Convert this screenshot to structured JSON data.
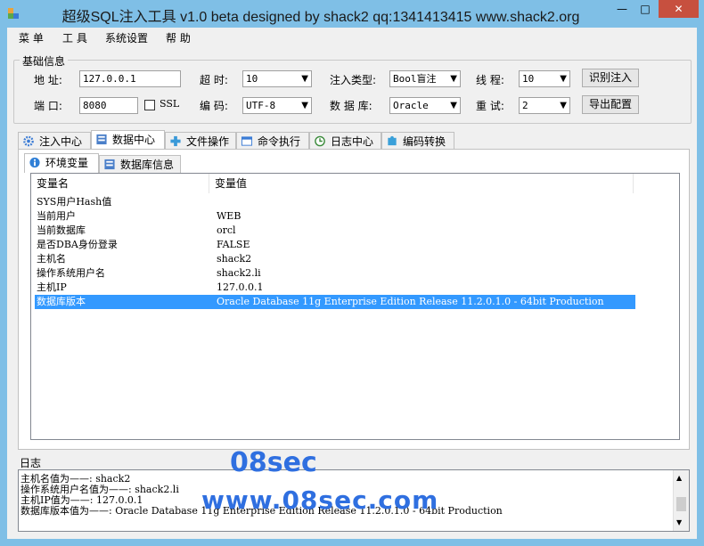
{
  "window": {
    "title": "超级SQL注入工具 v1.0 beta designed by shack2 qq:1341413415 www.shack2.org",
    "minimize_glyph": "—",
    "maximize_glyph": "□",
    "close_glyph": "✕"
  },
  "menu": [
    "菜 单",
    "工 具",
    "系统设置",
    "帮 助"
  ],
  "basic": {
    "group_title": "基础信息",
    "address_label": "地 址:",
    "address_value": "127.0.0.1",
    "port_label": "端 口:",
    "port_value": "8080",
    "ssl_label": "SSL",
    "timeout_label": "超 时:",
    "timeout_value": "10",
    "encoding_label": "编 码:",
    "encoding_value": "UTF-8",
    "inject_type_label": "注入类型:",
    "inject_type_value": "Bool盲注",
    "database_label": "数 据 库:",
    "database_value": "Oracle",
    "threads_label": "线 程:",
    "threads_value": "10",
    "retry_label": "重 试:",
    "retry_value": "2",
    "identify_button": "识别注入",
    "export_button": "导出配置"
  },
  "tabs": [
    "注入中心",
    "数据中心",
    "文件操作",
    "命令执行",
    "日志中心",
    "编码转换"
  ],
  "subtabs": [
    "环境变量",
    "数据库信息"
  ],
  "table": {
    "headers": [
      "变量名",
      "变量值"
    ],
    "rows": [
      [
        "SYS用户Hash值",
        ""
      ],
      [
        "当前用户",
        "WEB"
      ],
      [
        "当前数据库",
        "orcl"
      ],
      [
        "是否DBA身份登录",
        "FALSE"
      ],
      [
        "主机名",
        "shack2"
      ],
      [
        "操作系统用户名",
        "shack2.li"
      ],
      [
        "主机IP",
        "127.0.0.1"
      ],
      [
        "数据库版本",
        "Oracle Database 11g Enterprise Edition Release 11.2.0.1.0 - 64bit Production"
      ]
    ]
  },
  "log": {
    "title": "日志",
    "lines": [
      "主机名值为——: shack2",
      "操作系统用户名值为——: shack2.li",
      "主机IP值为——: 127.0.0.1",
      "数据库版本值为——: Oracle Database 11g Enterprise Edition Release 11.2.0.1.0 - 64bit Production"
    ]
  },
  "watermark": {
    "line1": "08sec",
    "line2": "www.08sec.com"
  },
  "colors": {
    "selection": "#3399ff",
    "frame": "#7fbfe6",
    "close": "#c7503f",
    "watermark": "#2f6fe0"
  }
}
